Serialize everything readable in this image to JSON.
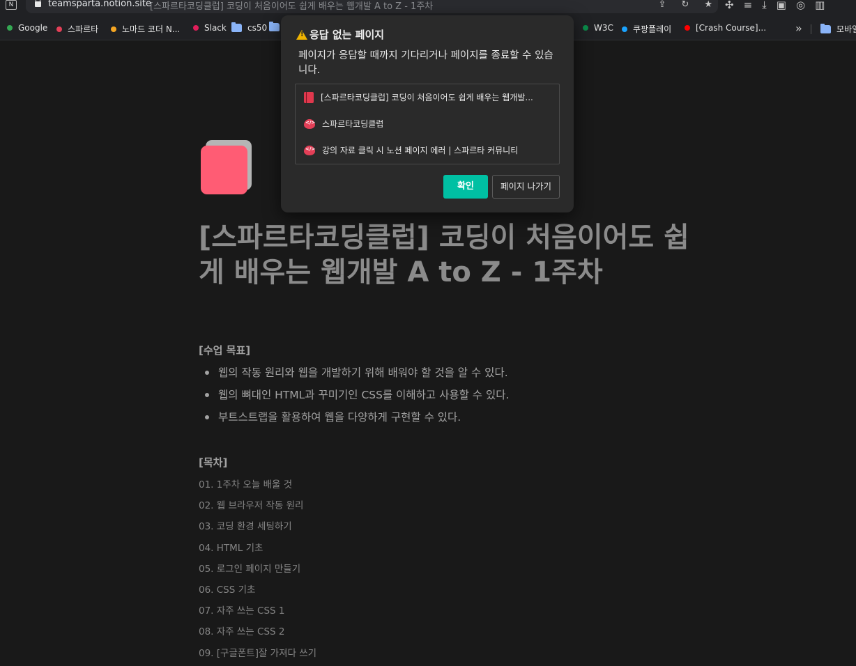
{
  "browser": {
    "url_host": "teamsparta.notion.site",
    "url_title": "[스파르타코딩클럽] 코딩이 처음이어도 쉽게 배우는 웹개발 A to Z - 1주차"
  },
  "bookmarks": [
    {
      "label": "Google",
      "color": "#34a853"
    },
    {
      "label": "스파르타",
      "color": "#e33f57"
    },
    {
      "label": "노마드 코더 N...",
      "color": "#f5a623"
    },
    {
      "label": "Slack",
      "color": "#e01e5a"
    },
    {
      "label": "cs50",
      "color": "folder"
    },
    {
      "label": "W3C",
      "color": "#0b8a4a"
    },
    {
      "label": "쿠팡플레이",
      "color": "#1aa3ff"
    },
    {
      "label": "[Crash Course]...",
      "color": "#ff0000"
    },
    {
      "label": "모바일",
      "color": "folder"
    }
  ],
  "dialog": {
    "title": "응답 없는 페이지",
    "message": "페이지가 응답할 때까지 기다리거나 페이지를 종료할 수 있습니다.",
    "pages": [
      {
        "label": "[스파르타코딩클럽] 코딩이 처음이어도 쉽게 배우는 웹개발...",
        "icon": "book-icon"
      },
      {
        "label": "스파르타코딩클럽",
        "icon": "sparta-icon"
      },
      {
        "label": "강의 자료 클릭 시 노션 페이지 에러 | 스파르타 커뮤니티",
        "icon": "sparta-icon"
      }
    ],
    "ok_label": "확인",
    "leave_label": "페이지 나가기"
  },
  "page": {
    "title": "[스파르타코딩클럽] 코딩이 처음이어도 쉽게 배우는 웹개발 A to Z - 1주차",
    "goals_heading": "[수업 목표]",
    "goals": [
      "웹의 작동 원리와 웹을 개발하기 위해 배워야 할 것을 알 수 있다.",
      "웹의 뼈대인 HTML과 꾸미기인 CSS를 이해하고 사용할 수 있다.",
      "부트스트랩을 활용하여 웹을 다양하게 구현할 수 있다."
    ],
    "toc_heading": "[목차]",
    "toc": [
      "01. 1주차 오늘 배울 것",
      "02. 웹 브라우저 작동 원리",
      "03. 코딩 환경 세팅하기",
      "04. HTML 기초",
      "05. 로그인 페이지 만들기",
      "06. CSS 기초",
      "07. 자주 쓰는 CSS 1",
      "08. 자주 쓰는 CSS 2",
      "09. [구글폰트]잘 가져다 쓰기"
    ]
  }
}
